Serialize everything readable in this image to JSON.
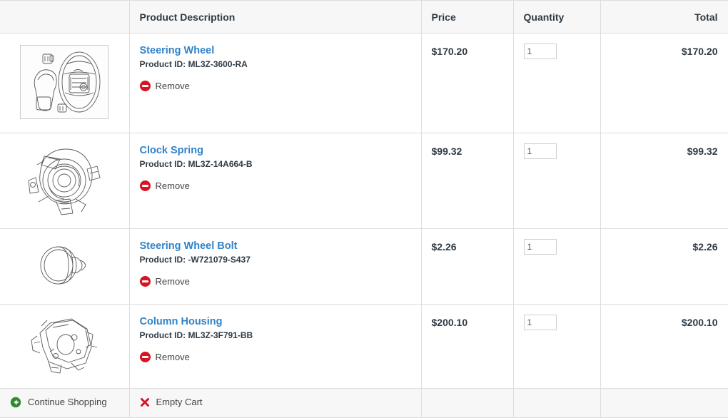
{
  "table": {
    "columns": [
      {
        "key": "image",
        "label": "",
        "align": "left"
      },
      {
        "key": "desc",
        "label": "Product Description",
        "align": "left"
      },
      {
        "key": "price",
        "label": "Price",
        "align": "left"
      },
      {
        "key": "quantity",
        "label": "Quantity",
        "align": "left"
      },
      {
        "key": "total",
        "label": "Total",
        "align": "right"
      }
    ],
    "headers": {
      "image": "",
      "description": "Product Description",
      "price": "Price",
      "quantity": "Quantity",
      "total": "Total"
    }
  },
  "items": [
    {
      "image_icon": "steering-wheel-line-drawing",
      "name": "Steering Wheel",
      "product_id_label": "Product ID: ML3Z-3600-RA",
      "product_id": "ML3Z-3600-RA",
      "remove_label": "Remove",
      "remove_icon": "remove-circle-icon",
      "price": "$170.20",
      "quantity": "1",
      "total": "$170.20"
    },
    {
      "image_icon": "clock-spring-line-drawing",
      "name": "Clock Spring",
      "product_id_label": "Product ID: ML3Z-14A664-B",
      "product_id": "ML3Z-14A664-B",
      "remove_label": "Remove",
      "remove_icon": "remove-circle-icon",
      "price": "$99.32",
      "quantity": "1",
      "total": "$99.32"
    },
    {
      "image_icon": "steering-wheel-bolt-line-drawing",
      "name": "Steering Wheel Bolt",
      "product_id_label": "Product ID: -W721079-S437",
      "product_id": "-W721079-S437",
      "remove_label": "Remove",
      "remove_icon": "remove-circle-icon",
      "price": "$2.26",
      "quantity": "1",
      "total": "$2.26"
    },
    {
      "image_icon": "column-housing-line-drawing",
      "name": "Column Housing",
      "product_id_label": "Product ID: ML3Z-3F791-BB",
      "product_id": "ML3Z-3F791-BB",
      "remove_label": "Remove",
      "remove_icon": "remove-circle-icon",
      "price": "$200.10",
      "quantity": "1",
      "total": "$200.10"
    }
  ],
  "footer": {
    "continue_shopping": "Continue Shopping",
    "continue_shopping_icon": "circle-back-arrow-icon",
    "empty_cart": "Empty Cart",
    "empty_cart_icon": "red-cross-icon"
  },
  "colors": {
    "link_blue": "#3183c8",
    "text_dark": "#2f3a44",
    "remove_red": "#d81324",
    "cross_red": "#d81324",
    "back_green": "#2e8b2e",
    "border": "#dddddd",
    "header_bg": "#f7f7f7"
  }
}
